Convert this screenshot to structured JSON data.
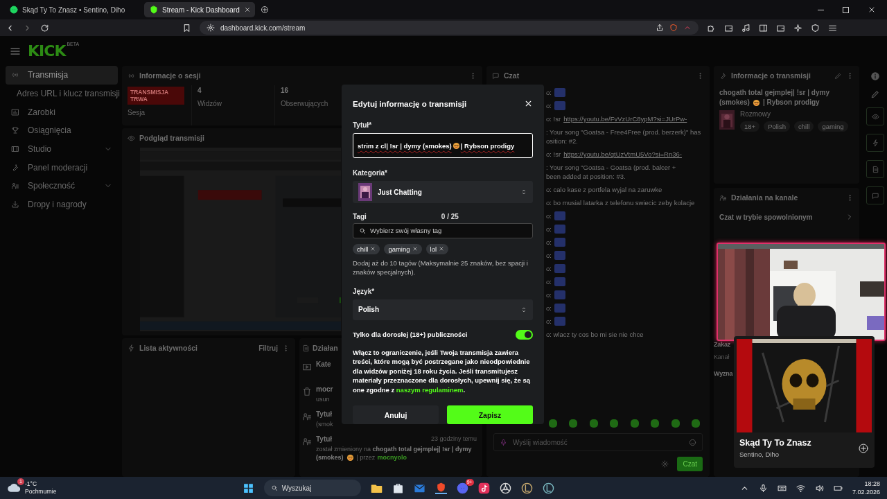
{
  "browser": {
    "tabs": [
      {
        "title": "Skąd Ty To Znasz • Sentino, Diho",
        "selected": false
      },
      {
        "title": "Stream - Kick Dashboard",
        "selected": true
      }
    ],
    "url": "dashboard.kick.com/stream"
  },
  "header": {
    "logo": "KICK",
    "logo_badge": "BETA"
  },
  "sidebar": {
    "items": [
      {
        "label": "Transmisja",
        "selected": true,
        "kind": "main"
      },
      {
        "label": "Adres URL i klucz transmisji",
        "selected": false,
        "kind": "sub"
      },
      {
        "label": "Zarobki",
        "selected": false,
        "kind": "main"
      },
      {
        "label": "Osiągnięcia",
        "selected": false,
        "kind": "main"
      },
      {
        "label": "Studio",
        "selected": false,
        "kind": "group"
      },
      {
        "label": "Panel moderacji",
        "selected": false,
        "kind": "main"
      },
      {
        "label": "Społeczność",
        "selected": false,
        "kind": "group"
      },
      {
        "label": "Dropy i nagrody",
        "selected": false,
        "kind": "main"
      }
    ]
  },
  "session": {
    "title": "Informacje o sesji",
    "status": "TRANSMISJA TRWA",
    "status_label": "Sesja",
    "stats": [
      {
        "value": "4",
        "label": "Widzów"
      },
      {
        "value": "16",
        "label": "Obserwujących"
      }
    ]
  },
  "preview": {
    "title": "Podgląd transmisji"
  },
  "activity": {
    "title": "Lista aktywności",
    "filter": "Filtruj"
  },
  "channel_log": {
    "title": "Działan",
    "items": [
      {
        "lines": [
          "Kate"
        ]
      },
      {
        "lines": [
          "mocr",
          "usun"
        ]
      },
      {
        "lines": [
          "Tytuł",
          "(smok"
        ]
      },
      {
        "title": "Tytuł",
        "time": "23 godziny temu",
        "before": "został zmieniony na **chogath total gejmplej| !sr | dymy**",
        "before2": "(smokes)",
        "after": "| przez",
        "user": "mocnyolo"
      }
    ]
  },
  "chat": {
    "title": "Czat",
    "messages": [
      {
        "kind": "emote",
        "prefix": "o:"
      },
      {
        "kind": "emote",
        "prefix": "o:"
      },
      {
        "kind": "link",
        "prefix": "o: !sr",
        "link": "https://youtu.be/FvVzUrC8ypM?si=JUrPw-"
      },
      {
        "kind": "text",
        "lines": [
          ": Your song \"Goatsa - Free4Free (prod. berzerk)\" has",
          "osition: #2."
        ]
      },
      {
        "kind": "link",
        "prefix": "o: !sr",
        "link": "https://youtu.be/qtUzVtmU5Vo?si=Rn36-"
      },
      {
        "kind": "text",
        "lines": [
          ": Your song \"Goatsa - Goatsa (prod. balcer +",
          "been added at position: #3."
        ]
      },
      {
        "kind": "text",
        "lines": [
          "o: calo kase z portfela wyjal na zaruwke"
        ]
      },
      {
        "kind": "text",
        "lines": [
          "o: bo musial latarka z telefonu swiecic zeby kolacje"
        ]
      },
      {
        "kind": "emote",
        "prefix": "o:"
      },
      {
        "kind": "emote",
        "prefix": "o:"
      },
      {
        "kind": "emote",
        "prefix": "o:"
      },
      {
        "kind": "emote",
        "prefix": "o:"
      },
      {
        "kind": "emote",
        "prefix": "o:"
      },
      {
        "kind": "emote",
        "prefix": "o:"
      },
      {
        "kind": "emote",
        "prefix": "o:"
      },
      {
        "kind": "emote",
        "prefix": "o:"
      },
      {
        "kind": "emote",
        "prefix": "o:"
      },
      {
        "kind": "text",
        "lines": [
          "o: wlacz ty cos bo mi sie nie chce"
        ]
      }
    ],
    "placeholder": "Wyślij wiadomość",
    "send": "Czat"
  },
  "stream_info": {
    "title": "Informacje o transmisji",
    "stream_title_before": "chogath total gejmplej| !sr | dymy",
    "stream_title_mid": "(smokes)",
    "stream_title_after": "| Rybson prodigy",
    "category": "Rozmowy",
    "tags": [
      "18+",
      "Polish",
      "chill",
      "gaming"
    ]
  },
  "channel_actions": {
    "title": "Działania na kanale",
    "rows": [
      {
        "label": "Czat w trybie spowolnionym",
        "kind": "main"
      },
      {
        "label": "Zakaz",
        "kind": "main"
      },
      {
        "label": "Kanał",
        "kind": "sub"
      },
      {
        "label": "Wyzna",
        "kind": "main"
      }
    ]
  },
  "modal": {
    "title": "Edytuj informację o transmisji",
    "title_label": "Tytuł*",
    "title_before": "strim z cl| !sr | dymy (smokes)",
    "title_after": "| Rybson prodigy",
    "category_label": "Kategoria*",
    "category": "Just Chatting",
    "tags_label": "Tagi",
    "tags_count": "0 / 25",
    "tag_placeholder": "Wybierz swój własny tag",
    "tags": [
      "chill",
      "gaming",
      "lol"
    ],
    "tags_help": "Dodaj aż do 10 tagów (Maksymalnie 25 znaków, bez spacji i znaków specjalnych).",
    "language_label": "Język*",
    "language": "Polish",
    "adult_label": "Tylko dla dorosłej (18+) publiczności",
    "adult_on": true,
    "notice": "Włącz to ograniczenie, jeśli Twoja transmisja zawiera treści, które mogą być postrzegane jako nieodpowiednie dla widzów poniżej 18 roku życia. Jeśli transmitujesz materiały przeznaczone dla dorosłych, upewnij się, że są one zgodne z",
    "notice_link": "naszym regulaminem",
    "notice_end": ".",
    "cancel": "Anuluj",
    "save": "Zapisz"
  },
  "now_playing": {
    "track": "Skąd Ty To Znasz",
    "artist": "Sentino, Diho"
  },
  "taskbar": {
    "weather_badge": "1",
    "temperature": "-1°C",
    "weather": "Pochmurnie",
    "search": "Wyszukaj",
    "discord_badge": "9+",
    "time": "18:28",
    "date": "7.02.2026"
  }
}
